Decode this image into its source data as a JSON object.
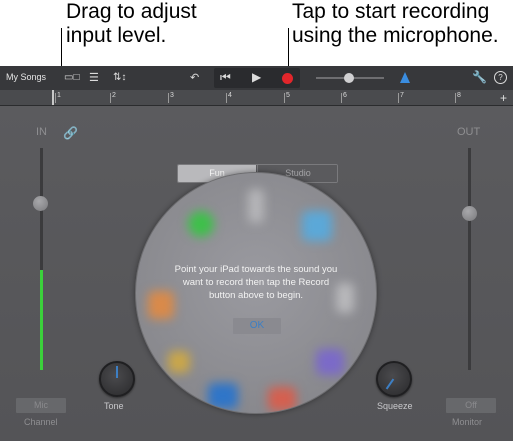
{
  "callouts": {
    "left": [
      "Drag to adjust",
      "input level."
    ],
    "right": [
      "Tap to start recording",
      "using the microphone."
    ]
  },
  "toolbar": {
    "my_songs": "My Songs",
    "icons": [
      "view-toggle-icon",
      "tracks-icon",
      "mixer-icon",
      "undo-icon",
      "rewind-icon",
      "play-icon",
      "record-icon",
      "master-volume-slider",
      "metronome-icon",
      "settings-wrench-icon",
      "help-icon"
    ],
    "help_glyph": "?",
    "master_volume_level": 0.45
  },
  "ruler": {
    "bars": [
      "1",
      "2",
      "3",
      "4",
      "5",
      "6",
      "7",
      "8"
    ],
    "add_glyph": "+"
  },
  "segmented": {
    "options": [
      "Fun",
      "Studio"
    ],
    "selected": "Fun"
  },
  "input": {
    "label": "IN",
    "level": 0.35,
    "slider_level": 0.82
  },
  "output": {
    "label": "OUT",
    "slider_level": 0.62
  },
  "message": {
    "lines": [
      "Point your iPad towards the sound you",
      "want to record then tap the Record",
      "button above to begin."
    ],
    "ok": "OK"
  },
  "knobs": {
    "tone": "Tone",
    "squeeze": "Squeeze"
  },
  "bottom": {
    "mic_button": "Mic",
    "channel_label": "Channel",
    "off_button": "Off",
    "monitor_label": "Monitor"
  },
  "colors": {
    "accent_blue": "#3d7fc4",
    "record_red": "#e2262b",
    "level_green": "#3bd13b",
    "metronome_blue": "#3a8de0"
  }
}
